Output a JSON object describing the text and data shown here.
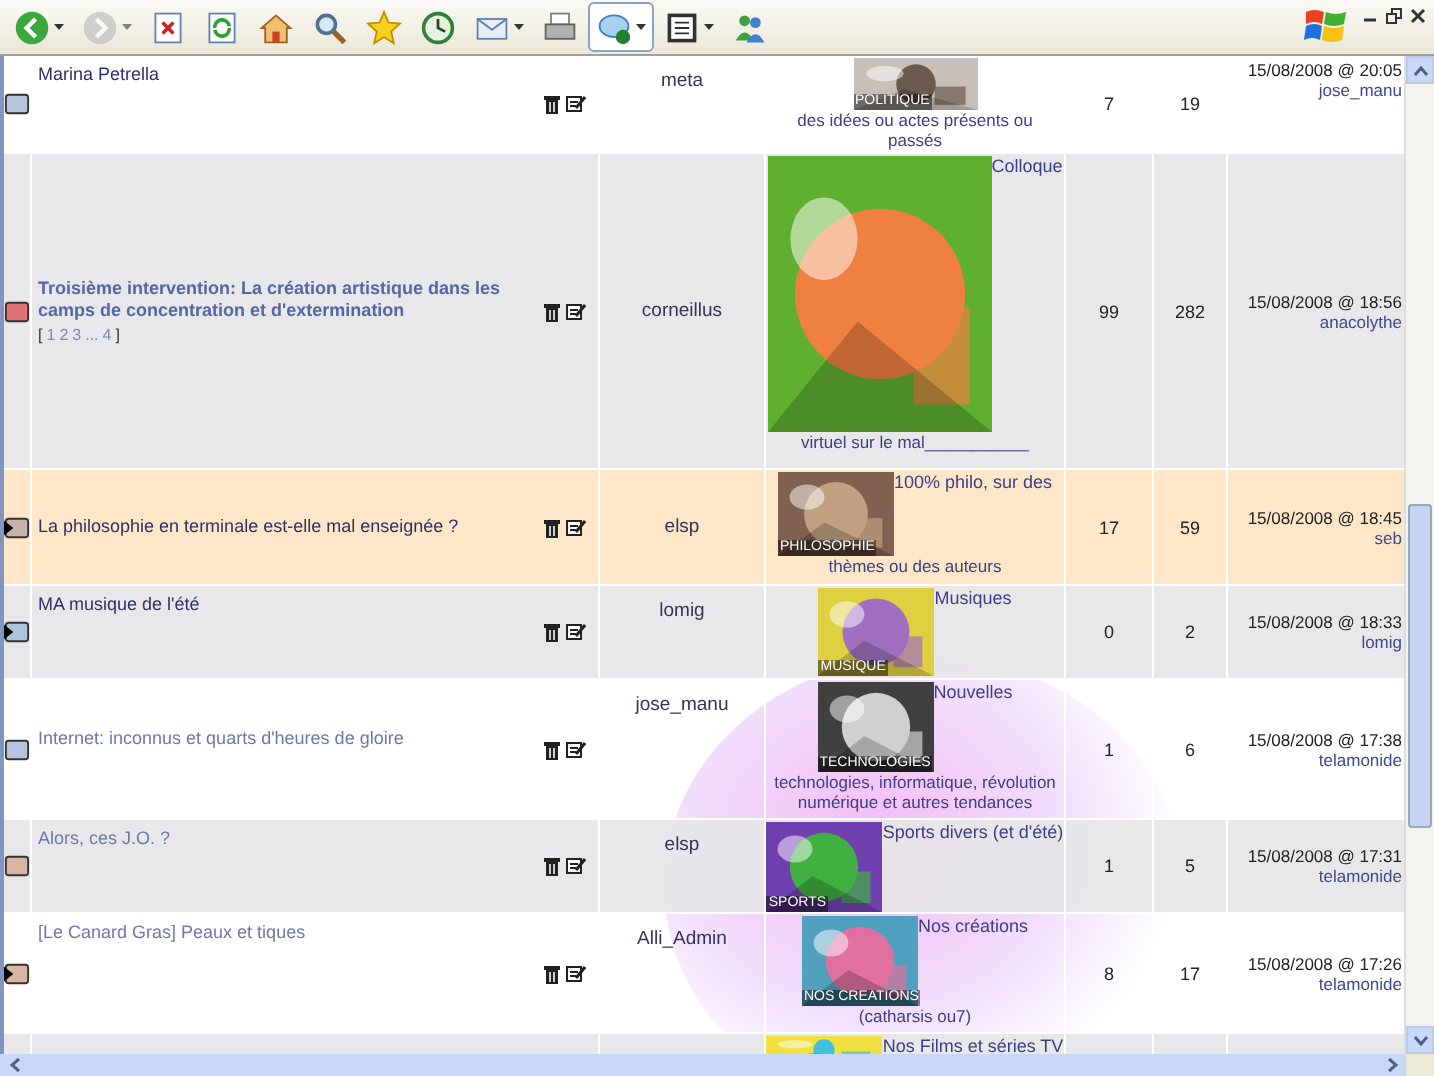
{
  "toolbar": {
    "buttons": [
      {
        "kind": "back",
        "disabled": false,
        "dropdown": true
      },
      {
        "kind": "forward",
        "disabled": true,
        "dropdown": true
      },
      {
        "kind": "stop",
        "disabled": false,
        "dropdown": false
      },
      {
        "kind": "refresh",
        "disabled": false,
        "dropdown": false
      },
      {
        "kind": "home",
        "disabled": false,
        "dropdown": false
      },
      {
        "kind": "search",
        "disabled": false,
        "dropdown": false
      },
      {
        "kind": "favorites",
        "disabled": false,
        "dropdown": false
      },
      {
        "kind": "history",
        "disabled": false,
        "dropdown": false
      },
      {
        "kind": "mail",
        "disabled": false,
        "dropdown": true
      },
      {
        "kind": "print",
        "disabled": false,
        "dropdown": false
      },
      {
        "kind": "messenger",
        "disabled": false,
        "dropdown": true,
        "selected": true
      },
      {
        "kind": "research",
        "disabled": false,
        "dropdown": true
      },
      {
        "kind": "contacts",
        "disabled": false,
        "dropdown": false
      }
    ]
  },
  "topics": [
    {
      "color": "#b4c4dc",
      "unread": false,
      "visited": false,
      "bold": false,
      "highlighted": false,
      "title": "Marina Petrella",
      "author": "meta",
      "image_label": "POLITIQUE",
      "description": "des idées ou actes présents ou passés",
      "replies": "7",
      "views": "19",
      "last_date": "15/08/2008 @ 20:05",
      "last_user": "jose_manu"
    },
    {
      "color": "#e07474",
      "unread": false,
      "visited": false,
      "bold": true,
      "highlighted": false,
      "title": "Troisième intervention: La création artistique dans les camps de concentration et d'extermination",
      "pages": [
        "[",
        "1",
        "2",
        "3",
        "...",
        "4",
        "]"
      ],
      "author": "corneillus",
      "forum": "Colloque",
      "description": "virtuel sur le mal___________",
      "replies": "99",
      "views": "282",
      "last_date": "15/08/2008 @ 18:56",
      "last_user": "anacolythe"
    },
    {
      "color": "#c8b4ac",
      "unread": true,
      "visited": false,
      "bold": false,
      "highlighted": true,
      "title": "La philosophie en terminale est-elle mal enseignée ?",
      "author": "elsp",
      "forum": "100% philo, sur des",
      "image_label": "PHILOSOPHIE",
      "description": "thèmes ou des auteurs",
      "replies": "17",
      "views": "59",
      "last_date": "15/08/2008 @ 18:45",
      "last_user": "seb"
    },
    {
      "color": "#acc4dc",
      "unread": true,
      "visited": false,
      "bold": false,
      "highlighted": false,
      "title": "MA musique de l'été",
      "author": "lomig",
      "forum": "Musiques",
      "image_label": "MUSIQUE",
      "replies": "0",
      "views": "2",
      "last_date": "15/08/2008 @ 18:33",
      "last_user": "lomig"
    },
    {
      "color": "#b4c4dc",
      "unread": false,
      "visited": true,
      "bold": false,
      "highlighted": false,
      "title": "Internet: inconnus et quarts d'heures de gloire",
      "author": "jose_manu",
      "forum": "Nouvelles",
      "image_label": "TECHNOLOGIES",
      "description": "technologies, informatique, révolution numérique et autres tendances",
      "replies": "1",
      "views": "6",
      "last_date": "15/08/2008 @ 17:38",
      "last_user": "telamonide"
    },
    {
      "color": "#d8b4a4",
      "unread": false,
      "visited": true,
      "bold": false,
      "highlighted": false,
      "title": "Alors, ces J.O. ?",
      "author": "elsp",
      "forum": "Sports divers (et d'été)",
      "image_label": "SPORTS",
      "replies": "1",
      "views": "5",
      "last_date": "15/08/2008 @ 17:31",
      "last_user": "telamonide"
    },
    {
      "color": "#d8b4a4",
      "unread": true,
      "visited": true,
      "bold": false,
      "highlighted": false,
      "title": "[Le Canard Gras] Peaux et tiques",
      "author": "Alli_Admin",
      "forum": "Nos créations",
      "image_label": "NOS CREATIONS",
      "description": "(catharsis ou7)",
      "replies": "8",
      "views": "17",
      "last_date": "15/08/2008 @ 17:26",
      "last_user": "telamonide"
    },
    {
      "highlighted": false,
      "forum": "Nos Films et séries TV"
    }
  ]
}
